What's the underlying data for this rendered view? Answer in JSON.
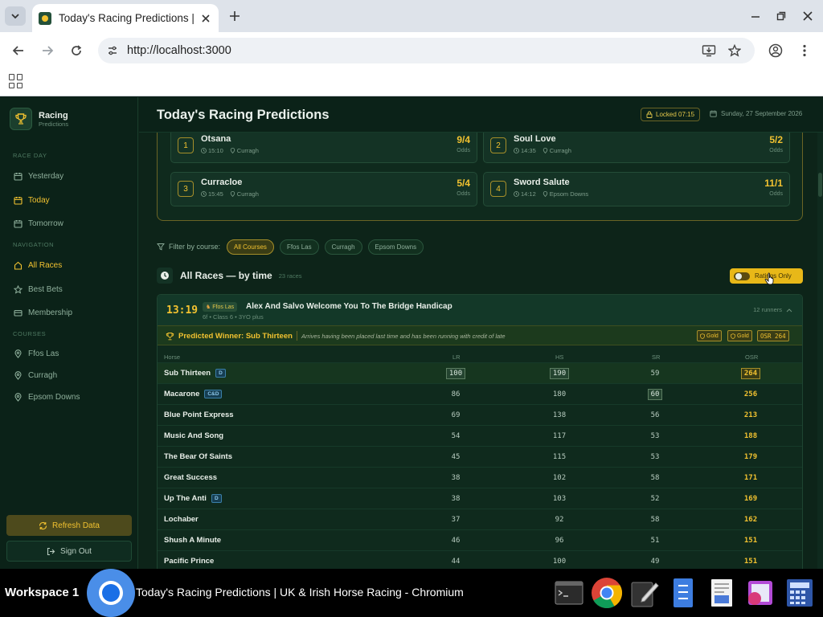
{
  "browser": {
    "tab_title": "Today's Racing Predictions | UK & Irish Horse Racing",
    "url": "http://localhost:3000"
  },
  "app": {
    "brand_title": "Racing",
    "brand_sub": "Predictions",
    "page_title": "Today's Racing Predictions",
    "locked_label": "Locked 07:15",
    "date_label": "Sunday, 27 September 2026"
  },
  "sidebar": {
    "race_day_label": "RACE DAY",
    "race_day": [
      "Yesterday",
      "Today",
      "Tomorrow"
    ],
    "navigation_label": "NAVIGATION",
    "navigation": [
      "All Races",
      "Best Bets",
      "Membership"
    ],
    "courses_label": "COURSES",
    "courses": [
      "Ffos Las",
      "Curragh",
      "Epsom Downs"
    ],
    "refresh_label": "Refresh Data",
    "signout_label": "Sign Out"
  },
  "naps": [
    {
      "rank": "1",
      "horse": "Otsana",
      "time": "15:10",
      "course": "Curragh",
      "odds": "9/4",
      "odds_label": "Odds"
    },
    {
      "rank": "2",
      "horse": "Soul Love",
      "time": "14:35",
      "course": "Curragh",
      "odds": "5/2",
      "odds_label": "Odds"
    },
    {
      "rank": "3",
      "horse": "Curracloe",
      "time": "15:45",
      "course": "Curragh",
      "odds": "5/4",
      "odds_label": "Odds"
    },
    {
      "rank": "4",
      "horse": "Sword Salute",
      "time": "14:12",
      "course": "Epsom Downs",
      "odds": "11/1",
      "odds_label": "Odds"
    }
  ],
  "filter": {
    "label": "Filter by course:",
    "chips": [
      "All Courses",
      "Ffos Las",
      "Curragh",
      "Epsom Downs"
    ],
    "active": "All Courses"
  },
  "section": {
    "title": "All Races — by time",
    "count": "23 races",
    "toggle_label": "Ratings Only"
  },
  "race": {
    "time": "13:19",
    "course": "Ffos Las",
    "name": "Alex And Salvo Welcome You To The Bridge Handicap",
    "sub": "6f • Class 6 • 3YO plus",
    "runners": "12 runners",
    "winner": "Predicted Winner: Sub Thirteen",
    "reason": "Arrives having been placed last time and has been running with credit of late",
    "tags": [
      "Gold",
      "Gold",
      "OSR 264"
    ],
    "columns": [
      "Horse",
      "LR",
      "HS",
      "SR",
      "OSR"
    ],
    "rows": [
      {
        "horse": "Sub Thirteen",
        "badge": "D",
        "lr": "100",
        "hs": "190",
        "sr": "59",
        "osr": "264"
      },
      {
        "horse": "Macarone",
        "badge": "C&D",
        "lr": "86",
        "hs": "180",
        "sr": "60",
        "osr": "256"
      },
      {
        "horse": "Blue Point Express",
        "badge": "",
        "lr": "69",
        "hs": "138",
        "sr": "56",
        "osr": "213"
      },
      {
        "horse": "Music And Song",
        "badge": "",
        "lr": "54",
        "hs": "117",
        "sr": "53",
        "osr": "188"
      },
      {
        "horse": "The Bear Of Saints",
        "badge": "",
        "lr": "45",
        "hs": "115",
        "sr": "53",
        "osr": "179"
      },
      {
        "horse": "Great Success",
        "badge": "",
        "lr": "38",
        "hs": "102",
        "sr": "58",
        "osr": "171"
      },
      {
        "horse": "Up The Anti",
        "badge": "D",
        "lr": "38",
        "hs": "103",
        "sr": "52",
        "osr": "169"
      },
      {
        "horse": "Lochaber",
        "badge": "",
        "lr": "37",
        "hs": "92",
        "sr": "58",
        "osr": "162"
      },
      {
        "horse": "Shush A Minute",
        "badge": "",
        "lr": "46",
        "hs": "96",
        "sr": "51",
        "osr": "151"
      },
      {
        "horse": "Pacific Prince",
        "badge": "",
        "lr": "44",
        "hs": "100",
        "sr": "49",
        "osr": "151"
      }
    ]
  },
  "taskbar": {
    "workspace": "Workspace 1",
    "window_title": "Today's Racing Predictions | UK & Irish Horse Racing - Chromium"
  },
  "colors": {
    "accent": "#f2c230",
    "background": "#0d2419",
    "sidebar": "#0b2218"
  }
}
